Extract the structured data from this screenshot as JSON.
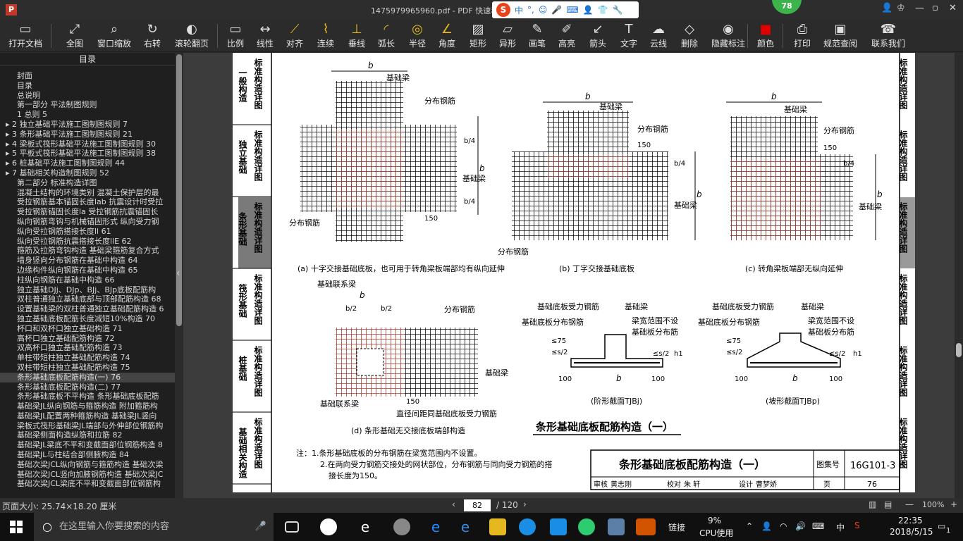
{
  "titlebar": {
    "title": "1475979965960.pdf - PDF 快速看图",
    "app_icon": "P",
    "ime_logo": "S",
    "ime_mode": "中",
    "badge": "78"
  },
  "toolbar": {
    "items": [
      {
        "label": "打开文档",
        "icon": "folder-icon"
      },
      {
        "label": "全图",
        "icon": "fullview-icon"
      },
      {
        "label": "窗口缩放",
        "icon": "zoom-icon"
      },
      {
        "label": "右转",
        "icon": "rotate-icon"
      },
      {
        "label": "滚轮翻页",
        "icon": "mouse-icon"
      },
      {
        "label": "比例",
        "icon": "scale-icon"
      },
      {
        "label": "线性",
        "icon": "linear-icon"
      },
      {
        "label": "对齐",
        "icon": "align-icon"
      },
      {
        "label": "连续",
        "icon": "continuous-icon"
      },
      {
        "label": "垂线",
        "icon": "perpendicular-icon"
      },
      {
        "label": "弧长",
        "icon": "arc-icon"
      },
      {
        "label": "半径",
        "icon": "radius-icon"
      },
      {
        "label": "角度",
        "icon": "angle-icon"
      },
      {
        "label": "矩形",
        "icon": "rectangle-icon"
      },
      {
        "label": "异形",
        "icon": "polygon-icon"
      },
      {
        "label": "画笔",
        "icon": "pen-icon"
      },
      {
        "label": "高亮",
        "icon": "highlight-icon"
      },
      {
        "label": "箭头",
        "icon": "arrow-icon"
      },
      {
        "label": "文字",
        "icon": "text-icon"
      },
      {
        "label": "云线",
        "icon": "cloud-icon"
      },
      {
        "label": "删除",
        "icon": "eraser-icon"
      },
      {
        "label": "隐藏标注",
        "icon": "eye-off-icon"
      },
      {
        "label": "颜色",
        "icon": "color-icon"
      },
      {
        "label": "打印",
        "icon": "print-icon"
      },
      {
        "label": "规范查阅",
        "icon": "book-icon"
      },
      {
        "label": "联系我们",
        "icon": "contact-icon"
      }
    ]
  },
  "toc": {
    "title": "目录",
    "items": [
      "封面",
      "目录",
      "总说明",
      "第一部分 平法制图规则",
      "1 总则 5",
      "▸ 2 独立基础平法施工图制图规则 7",
      "▸ 3 条形基础平法施工图制图规则 21",
      "▸ 4 梁板式筏形基础平法施工图制图规则 30",
      "▸ 5 平板式筏形基础平法施工图制图规则 38",
      "▸ 6 桩基础平法施工图制图规则 44",
      "▸ 7 基础相关构造制图规则 52",
      "第二部分 标准构造详图",
      "混凝土结构的环境类别 混凝土保护层的最",
      "受拉钢筋基本锚固长度lab 抗震设计时受拉",
      "受拉钢筋锚固长度la 受拉钢筋抗震锚固长",
      "纵向钢筋弯钩与机械锚固形式 纵向受力钢",
      "纵向受拉钢筋搭接长度ll 61",
      "纵向受拉钢筋抗震搭接长度llE 62",
      "箍筋及拉筋弯钩构造 基础梁箍筋复合方式",
      "墙身竖向分布钢筋在基础中构造 64",
      "边缘构件纵向钢筋在基础中构造 65",
      "柱纵向钢筋在基础中构造 66",
      "独立基础DJj、DJp、BJj、BJp底板配筋构",
      "双柱普通独立基础底部与顶部配筋构造 68",
      "设置基础梁的双柱普通独立基础配筋构造 6",
      "独立基础底板配筋长度减短10%构造 70",
      "杯口和双杯口独立基础构造 71",
      "高杯口独立基础配筋构造 72",
      "双高杯口独立基础配筋构造 73",
      "单柱带短柱独立基础配筋构造 74",
      "双柱带短柱独立基础配筋构造 75",
      "条形基础底板配筋构造(一) 76",
      "条形基础底板配筋构造(二) 77",
      "条形基础底板不平构造 条形基础底板配筋",
      "基础梁JL纵向钢筋与箍筋构造 附加箍筋构",
      "基础梁JL配置两种箍筋构造 基础梁JL竖向",
      "梁板式筏形基础梁JL端部与外伸部位钢筋构",
      "基础梁侧面构造纵筋和拉筋 82",
      "基础梁JL梁底不平和变截面部位钢筋构造 8",
      "基础梁JL与柱结合部侧腋构造 84",
      "基础次梁JCL纵向钢筋与箍筋构造 基础次梁",
      "基础次梁JCL竖向加腋钢筋构造 基础次梁JC",
      "基础次梁JCL梁底不平和变截面部位钢筋构"
    ],
    "selected_index": 31
  },
  "document": {
    "left_tabs": [
      {
        "rot": "一般构造",
        "label": "标准构造详图"
      },
      {
        "rot": "独立基础",
        "label": "标准构造详图"
      },
      {
        "rot": "条形基础",
        "label": "标准构造详图"
      },
      {
        "rot": "筏形基础",
        "label": "标准构造详图"
      },
      {
        "rot": "桩基础",
        "label": "标准构造详图"
      },
      {
        "rot": "基础相关构造",
        "label": "标准构造详图"
      }
    ],
    "right_tabs": [
      "标准构造详图",
      "标准构造详图",
      "标准构造详图",
      "标准构造详图",
      "标准构造详图",
      "标准构造详图"
    ],
    "captions": {
      "a": "(a) 十字交接基础底板，也可用于转角梁板端部均有纵向延伸",
      "b": "(b) 丁字交接基础底板",
      "c": "(c) 转角梁板端部无纵向延伸",
      "d": "(d) 条形基础无交接底板端部构造",
      "e": "(阶形截面TJBj)",
      "f": "(坡形截面TJBp)"
    },
    "labels": {
      "b": "b",
      "b4": "b/4",
      "b2": "b/2",
      "beam": "基础梁",
      "dist": "分布钢筋",
      "150": "150",
      "100": "100",
      "link_beam": "基础联系梁",
      "main_bar": "直径间距同基础底板受力钢筋",
      "bottom_main": "基础底板受力钢筋",
      "bottom_dist": "基础底板分布钢筋",
      "beam_range": "梁宽范围不设",
      "plate_dist": "基础板分布筋",
      "lt75": "≤75",
      "s2": "≤s/2",
      "h1": "h1"
    },
    "heading": "条形基础底板配筋构造（一）",
    "notes": [
      "注：1.条形基础底板的分布钢筋在梁宽范围内不设置。",
      "2.在两向受力钢筋交接处的网状部位，分布钢筋与同向受力钢筋的搭",
      "接长度为150。"
    ],
    "titleblock": {
      "title": "条形基础底板配筋构造（一）",
      "atlas_label": "图集号",
      "atlas": "16G101-3",
      "review": "审核",
      "reviewer": "黄志刚",
      "check": "校对",
      "checker": "朱 轩",
      "design": "设计",
      "designer": "曹梦娇",
      "page_label": "页",
      "page": "76"
    }
  },
  "status": {
    "page_size": "页面大小: 25.74×18.20 厘米",
    "current_page": "82",
    "total_pages": "/ 120",
    "zoom": "100%"
  },
  "taskbar": {
    "search_placeholder": "在这里输入你要搜索的内容",
    "cpu_percent": "9%",
    "cpu_label": "CPU使用",
    "link": "链接",
    "ime": "中",
    "time": "22:35",
    "date": "2018/5/15",
    "notif": "1"
  },
  "colors": {
    "red": "#c0392b",
    "bg": "#2b2b2b",
    "accent": "#3cb44b"
  }
}
